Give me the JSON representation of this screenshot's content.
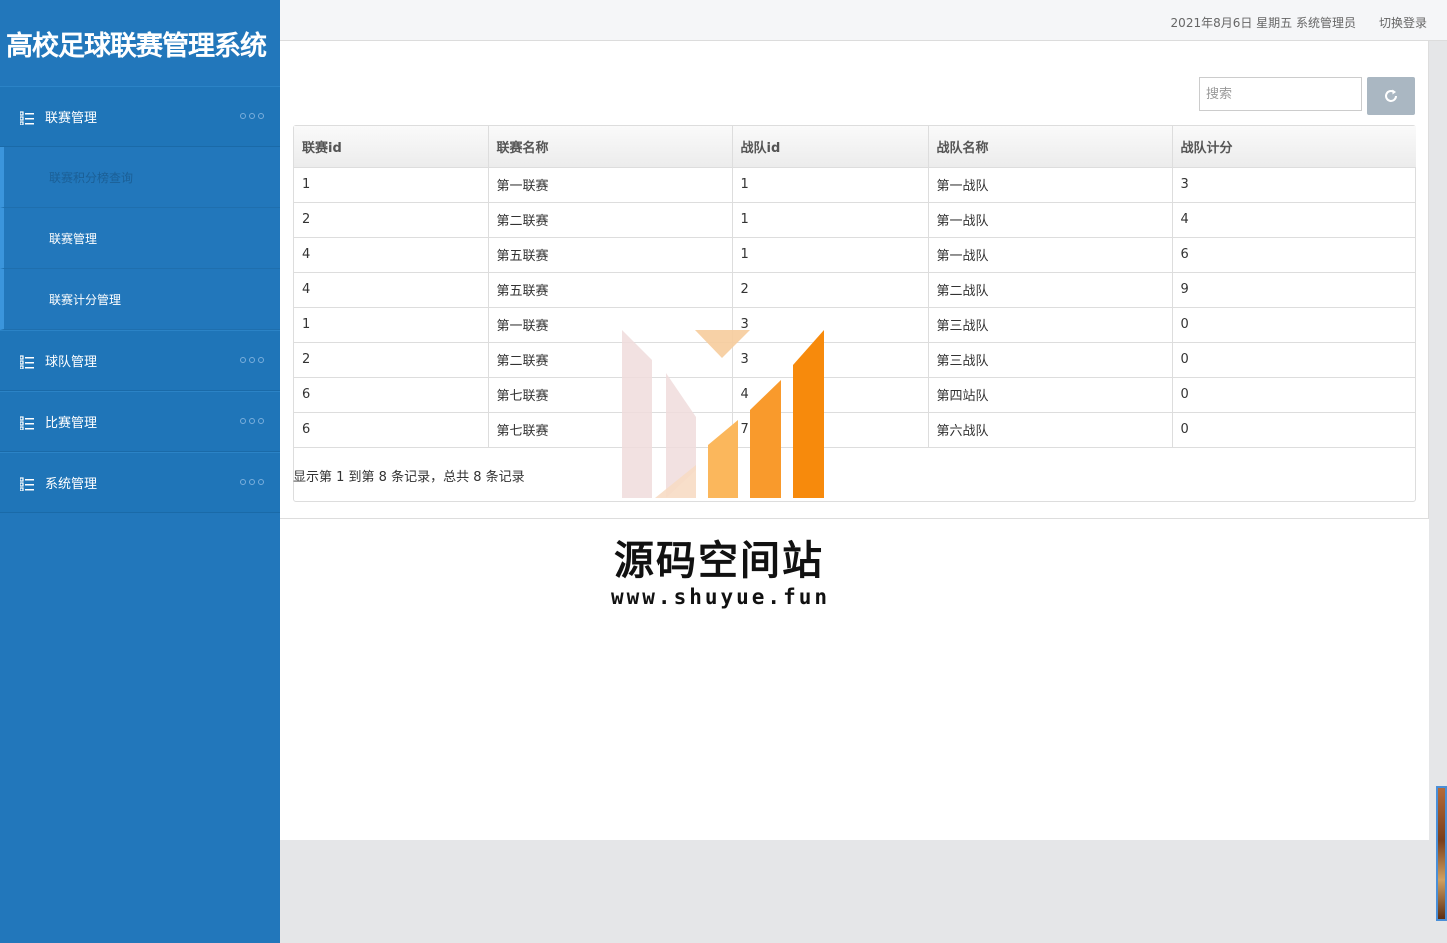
{
  "app": {
    "title": "高校足球联赛管理系统"
  },
  "header": {
    "date": "2021年8月6日 星期五 系统管理员",
    "switch_login": "切换登录"
  },
  "sidebar": {
    "groups": [
      {
        "label": "联赛管理",
        "icon": "list-icon",
        "children": [
          {
            "label": "联赛积分榜查询"
          },
          {
            "label": "联赛管理"
          },
          {
            "label": "联赛计分管理"
          }
        ]
      },
      {
        "label": "球队管理",
        "icon": "list-icon"
      },
      {
        "label": "比赛管理",
        "icon": "list-icon"
      },
      {
        "label": "系统管理",
        "icon": "list-icon"
      }
    ]
  },
  "toolbar": {
    "search_placeholder": "搜索",
    "refresh_icon": "refresh-icon"
  },
  "table": {
    "columns": [
      "联赛id",
      "联赛名称",
      "战队id",
      "战队名称",
      "战队计分"
    ],
    "rows": [
      [
        "1",
        "第一联赛",
        "1",
        "第一战队",
        "3"
      ],
      [
        "2",
        "第二联赛",
        "1",
        "第一战队",
        "4"
      ],
      [
        "4",
        "第五联赛",
        "1",
        "第一战队",
        "6"
      ],
      [
        "4",
        "第五联赛",
        "2",
        "第二战队",
        "9"
      ],
      [
        "1",
        "第一联赛",
        "3",
        "第三战队",
        "0"
      ],
      [
        "2",
        "第二联赛",
        "3",
        "第三战队",
        "0"
      ],
      [
        "6",
        "第七联赛",
        "4",
        "第四站队",
        "0"
      ],
      [
        "6",
        "第七联赛",
        "7",
        "第六战队",
        "0"
      ]
    ]
  },
  "pager": {
    "summary": "显示第 1 到第 8 条记录，总共 8 条记录"
  },
  "watermark": {
    "title": "源码空间站",
    "url": "www.shuyue.fun"
  },
  "colors": {
    "sidebar": "#2277bb",
    "accent": "#3b95dc",
    "watermark_orange": "#f78a0c"
  }
}
